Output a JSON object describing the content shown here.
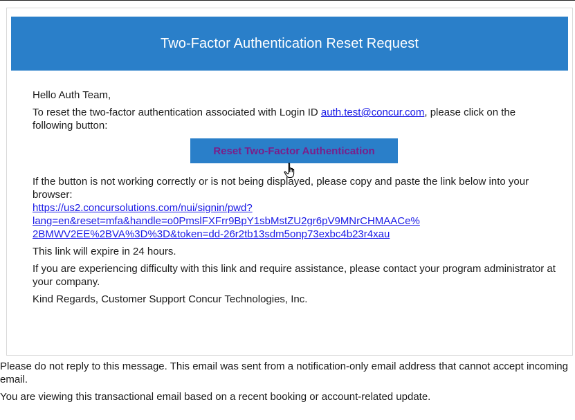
{
  "email": {
    "header_title": "Two-Factor Authentication Reset Request",
    "greeting": "Hello Auth Team,",
    "intro_before_link": "To reset the two-factor authentication associated with Login ID ",
    "login_id_link": "auth.test@concur.com",
    "intro_after_link": ", please click on the following button:",
    "reset_button_label": "Reset Two-Factor Authentication",
    "button_broken_text": "If the button is not working correctly or is not being displayed, please copy and paste the link below into your browser:",
    "reset_url_line1": "https://us2.concursolutions.com/nui/signin/pwd?",
    "reset_url_line2": "lang=en&reset=mfa&handle=o0PmslFXFrr9BpY1sbMstZU2gr6pV9MNrCHMAACe%",
    "reset_url_line3": "2BMWV2EE%2BVA%3D%3D&token=dd-26r2tb13sdm5onp73exbc4b23r4xau",
    "expire_text": "This link will expire in 24 hours.",
    "difficulty_text": "If you are experiencing difficulty with this link and require assistance, please contact your program administrator at your company.",
    "signoff_text": "Kind Regards, Customer Support Concur Technologies, Inc."
  },
  "footer": {
    "no_reply_text": "Please do not reply to this message. This email was sent from a notification-only email address that cannot accept incoming email.",
    "transactional_text": "You are viewing this transactional email based on a recent booking or account-related update."
  },
  "icons": {
    "cursor": "hand-pointer-icon"
  },
  "colors": {
    "header_bg": "#2a7fc9",
    "button_text": "#7a1e8a",
    "link": "#1a1ae6"
  }
}
